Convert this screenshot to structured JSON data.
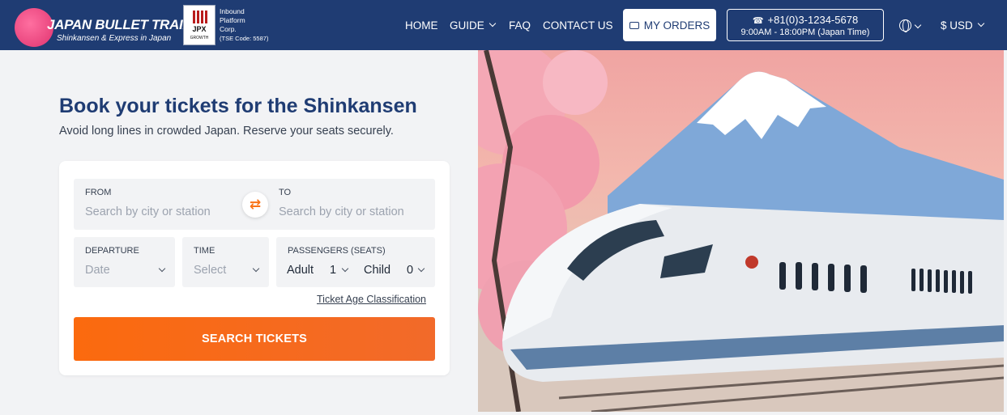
{
  "brand": {
    "title": "JAPAN BULLET TRAIN",
    "subtitle": "Shinkansen & Express in Japan",
    "partner_badge": "JPX",
    "partner_badge_sub": "GROWTH",
    "partner_line1": "Inbound",
    "partner_line2": "Platform",
    "partner_line3": "Corp.",
    "partner_line4": "(TSE Code: 5587)"
  },
  "nav": {
    "home": "HOME",
    "guide": "GUIDE",
    "faq": "FAQ",
    "contact": "CONTACT US",
    "orders": "MY ORDERS",
    "phone": "+81(0)3-1234-5678",
    "hours": "9:00AM - 18:00PM (Japan Time)",
    "currency": "$ USD"
  },
  "hero": {
    "headline": "Book your tickets for the Shinkansen",
    "subline": "Avoid long lines in crowded Japan. Reserve your seats securely."
  },
  "form": {
    "from_label": "FROM",
    "from_placeholder": "Search by city or station",
    "to_label": "TO",
    "to_placeholder": "Search by city or station",
    "departure_label": "DEPARTURE",
    "departure_value": "Date",
    "time_label": "TIME",
    "time_value": "Select",
    "passengers_label": "PASSENGERS (SEATS)",
    "adult_label": "Adult",
    "adult_count": "1",
    "child_label": "Child",
    "child_count": "0",
    "age_link": "Ticket Age Classification",
    "search_button": "SEARCH TICKETS"
  },
  "icons": {
    "swap": "swap-arrows-icon",
    "phone": "phone-icon",
    "ticket": "ticket-icon",
    "globe": "globe-icon"
  },
  "colors": {
    "header_bg": "#1f3c73",
    "accent": "#fb6a0e",
    "headline": "#1f3c73"
  }
}
